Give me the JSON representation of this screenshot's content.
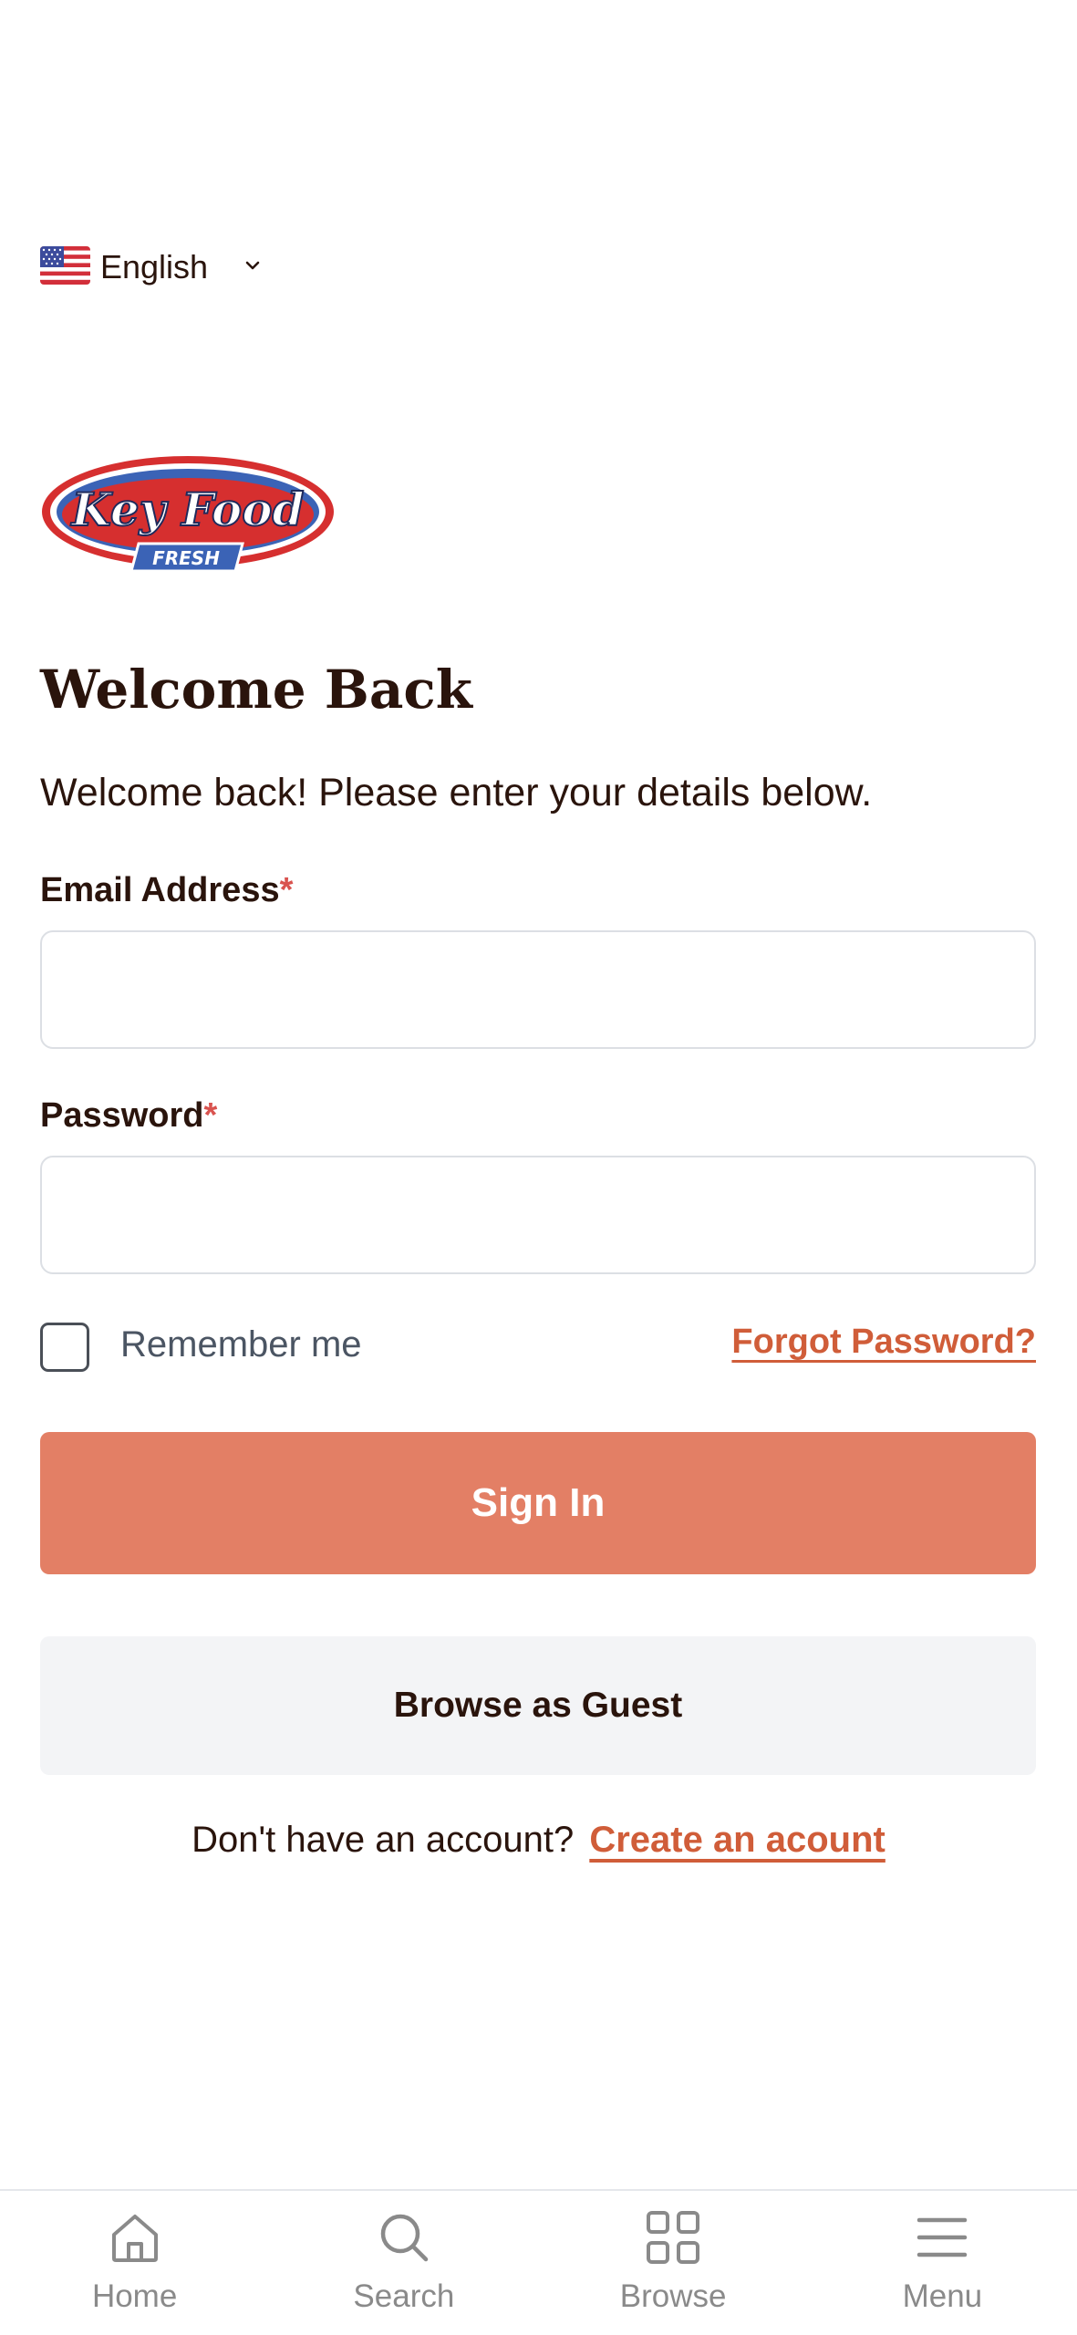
{
  "language": {
    "label": "English",
    "flag_icon": "us-flag-icon",
    "chevron_icon": "chevron-down-icon"
  },
  "brand": {
    "logo_line1": "Key Food",
    "logo_line2": "FRESH",
    "colors": {
      "red": "#d62f2f",
      "blue": "#3b63b6"
    }
  },
  "page": {
    "title": "Welcome Back",
    "subtitle": "Welcome back! Please enter your details below."
  },
  "form": {
    "email": {
      "label": "Email Address",
      "required_mark": "*",
      "value": "",
      "placeholder": ""
    },
    "password": {
      "label": "Password",
      "required_mark": "*",
      "value": "",
      "placeholder": ""
    },
    "remember_label": "Remember me",
    "forgot_label": "Forgot Password?",
    "signin_label": "Sign In",
    "guest_label": "Browse as Guest",
    "signup_question": "Don't have an account?",
    "signup_link": "Create an acount"
  },
  "colors": {
    "accent": "#e37f65",
    "link": "#d05d39",
    "text": "#2a140c",
    "guest_bg": "#f3f4f6"
  },
  "bottom_nav": {
    "items": [
      {
        "label": "Home",
        "icon": "home-icon"
      },
      {
        "label": "Search",
        "icon": "search-icon"
      },
      {
        "label": "Browse",
        "icon": "grid-icon"
      },
      {
        "label": "Menu",
        "icon": "menu-icon"
      }
    ]
  }
}
